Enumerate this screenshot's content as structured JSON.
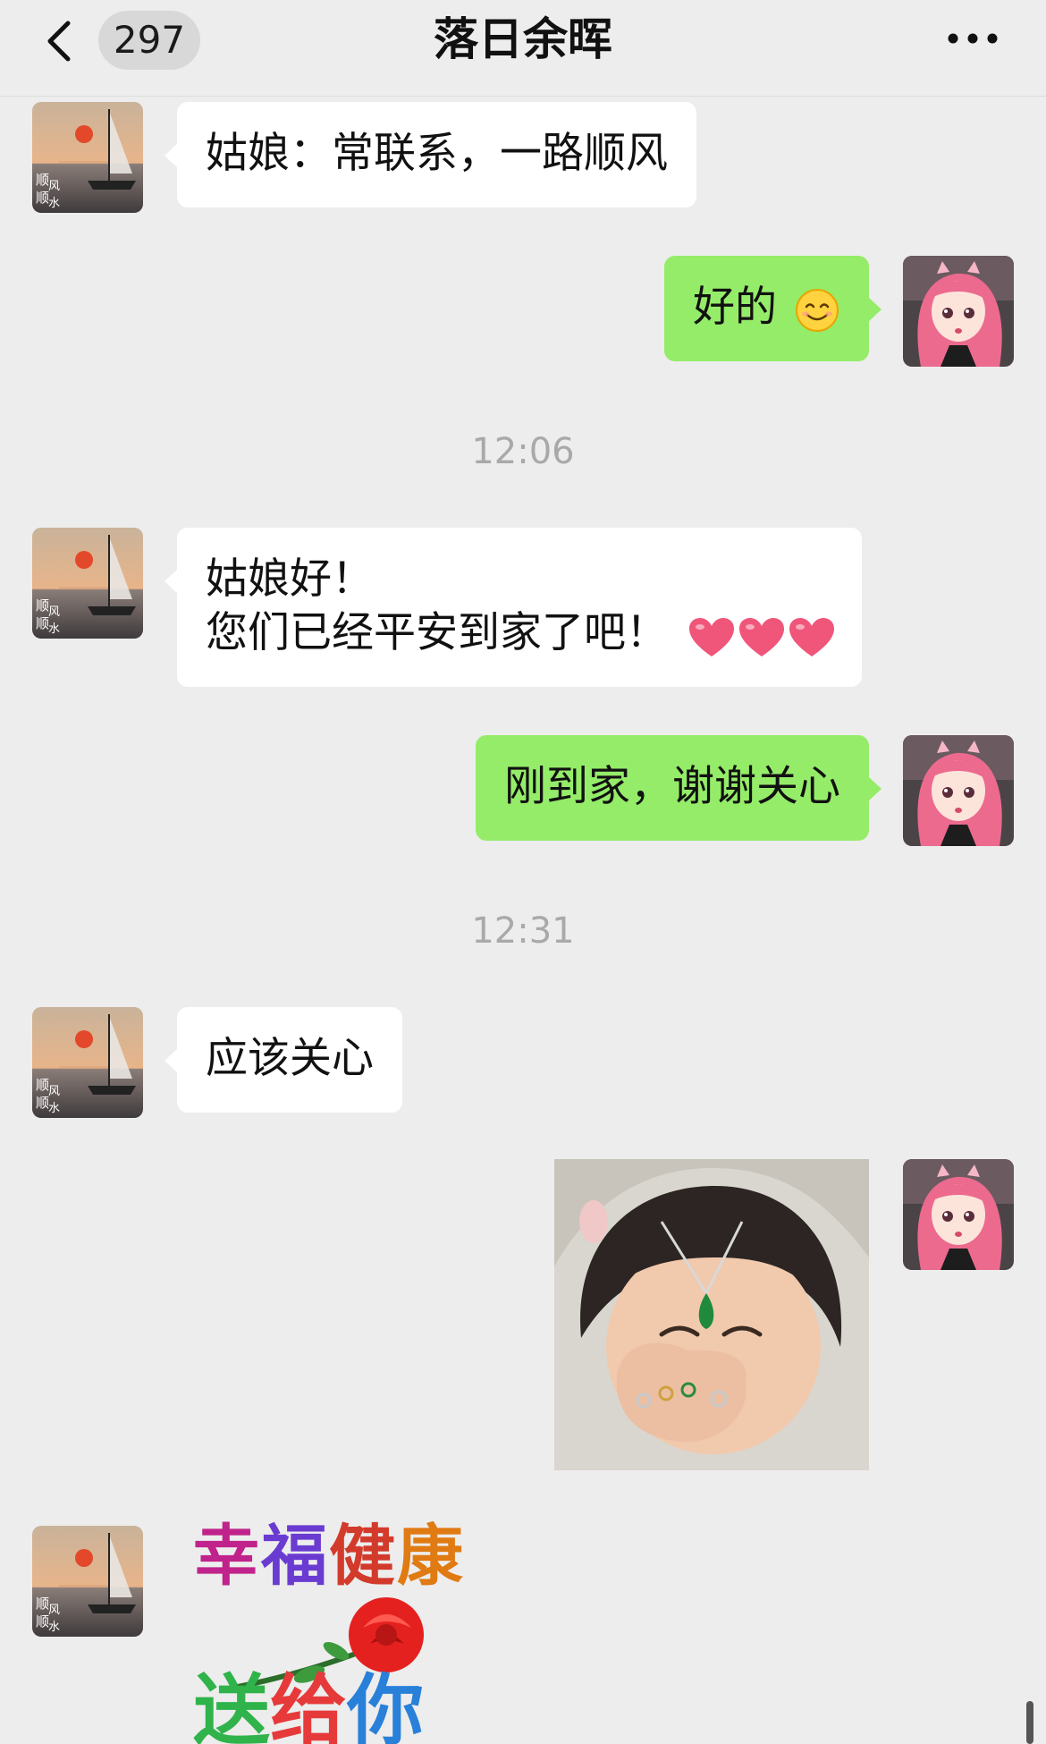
{
  "header": {
    "unread_count": "297",
    "title": "落日余晖"
  },
  "messages": [
    {
      "side": "in",
      "text": "姑娘：常联系，一路顺风"
    },
    {
      "side": "out",
      "text": "好的",
      "emoji": "smile-emoji"
    },
    {
      "timestamp": "12:06"
    },
    {
      "side": "in",
      "line1": "姑娘好！",
      "line2": "您们已经平安到家了吧！",
      "emoji": "heart-emoji x3"
    },
    {
      "side": "out",
      "text": "刚到家，谢谢关心"
    },
    {
      "timestamp": "12:31"
    },
    {
      "side": "in",
      "text": "应该关心"
    },
    {
      "side": "out",
      "type": "image"
    },
    {
      "side": "in",
      "type": "sticker",
      "sticker_line1": "幸福健康",
      "sticker_line2": "送给你"
    }
  ],
  "colors": {
    "background": "#ededed",
    "bubble_in": "#ffffff",
    "bubble_out": "#95ec69",
    "timestamp": "#a9a9a9"
  },
  "icons": [
    "back-arrow-icon",
    "more-dots-icon",
    "smile-emoji",
    "heart-emoji"
  ]
}
